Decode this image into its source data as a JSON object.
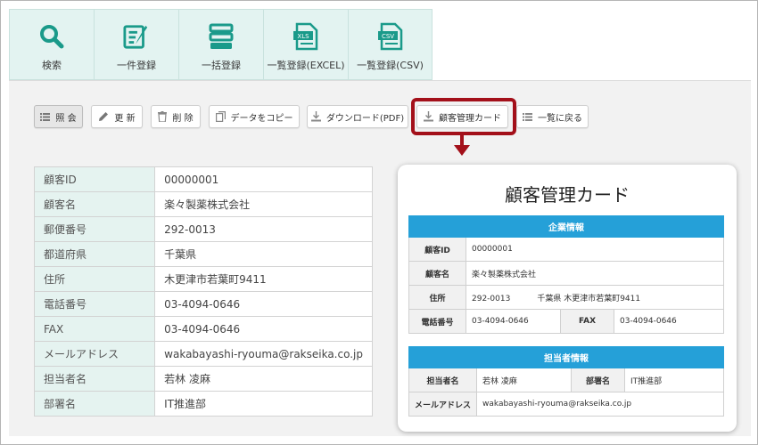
{
  "tabs": [
    {
      "label": "検索",
      "icon": "search-icon"
    },
    {
      "label": "一件登録",
      "icon": "edit-form-icon"
    },
    {
      "label": "一括登録",
      "icon": "stacked-list-icon"
    },
    {
      "label": "一覧登録(EXCEL)",
      "icon": "xls-file-icon",
      "badge": "XLS"
    },
    {
      "label": "一覧登録(CSV)",
      "icon": "csv-file-icon",
      "badge": "CSV"
    }
  ],
  "toolbar": {
    "view": "照 会",
    "update": "更 新",
    "delete": "削 除",
    "copy": "データをコピー",
    "download_pdf": "ダウンロード(PDF)",
    "customer_card": "顧客管理カード",
    "back_to_list": "一覧に戻る"
  },
  "detail": [
    {
      "key": "顧客ID",
      "value": "00000001"
    },
    {
      "key": "顧客名",
      "value": "楽々製薬株式会社"
    },
    {
      "key": "郵便番号",
      "value": "292-0013"
    },
    {
      "key": "都道府県",
      "value": "千葉県"
    },
    {
      "key": "住所",
      "value": "木更津市若葉町9411"
    },
    {
      "key": "電話番号",
      "value": "03-4094-0646"
    },
    {
      "key": "FAX",
      "value": "03-4094-0646"
    },
    {
      "key": "メールアドレス",
      "value": "wakabayashi-ryouma@rakseika.co.jp"
    },
    {
      "key": "担当者名",
      "value": "若林 凌麻"
    },
    {
      "key": "部署名",
      "value": "IT推進部"
    }
  ],
  "card": {
    "title": "顧客管理カード",
    "company_section": "企業情報",
    "customer_id_label": "顧客ID",
    "customer_id": "00000001",
    "customer_name_label": "顧客名",
    "customer_name": "楽々製薬株式会社",
    "address_label": "住所",
    "zip": "292-0013",
    "address": "千葉県 木更津市若葉町9411",
    "phone_label": "電話番号",
    "phone": "03-4094-0646",
    "fax_label": "FAX",
    "fax": "03-4094-0646",
    "contact_section": "担当者情報",
    "person_label": "担当者名",
    "person": "若林 凌麻",
    "dept_label": "部署名",
    "dept": "IT推進部",
    "email_label": "メールアドレス",
    "email": "wakabayashi-ryouma@rakseika.co.jp"
  },
  "colors": {
    "tab_bg": "#e3f3f1",
    "icon_teal": "#1a9a8a",
    "highlight": "#a3101a",
    "section_blue": "#25a0d8",
    "key_cell_bg": "#e5f3f0"
  }
}
